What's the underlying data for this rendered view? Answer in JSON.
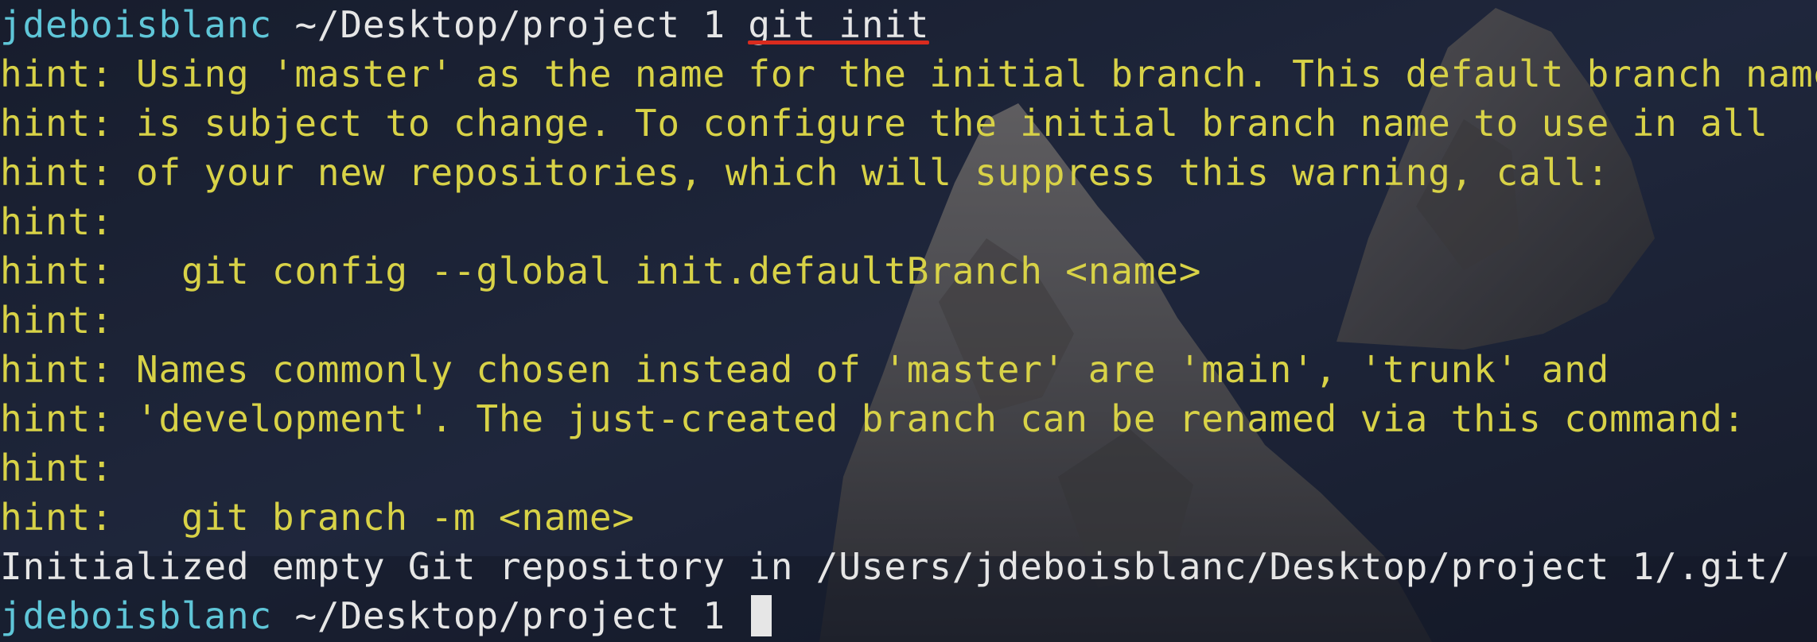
{
  "terminal": {
    "prompt": {
      "user": "jdeboisblanc",
      "path": "~/Desktop/project 1"
    },
    "command": "git init",
    "lines": [
      "hint: Using 'master' as the name for the initial branch. This default branch name",
      "hint: is subject to change. To configure the initial branch name to use in all",
      "hint: of your new repositories, which will suppress this warning, call:",
      "hint:",
      "hint:   git config --global init.defaultBranch <name>",
      "hint:",
      "hint: Names commonly chosen instead of 'master' are 'main', 'trunk' and",
      "hint: 'development'. The just-created branch can be renamed via this command:",
      "hint:",
      "hint:   git branch -m <name>"
    ],
    "output": "Initialized empty Git repository in /Users/jdeboisblanc/Desktop/project 1/.git/",
    "colors": {
      "user": "#5fc6d8",
      "hint": "#d8d247",
      "text": "#e6e6e6",
      "underline": "#d92b1e"
    }
  }
}
